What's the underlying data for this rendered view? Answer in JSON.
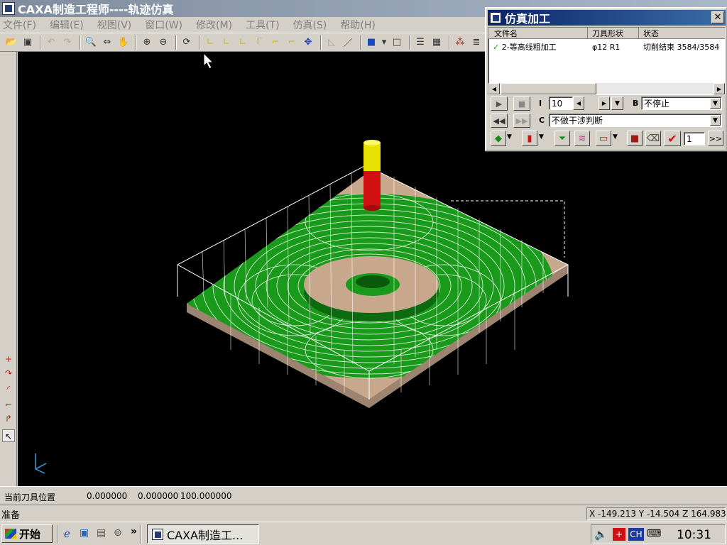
{
  "window": {
    "title": "CAXA制造工程师----轨迹仿真"
  },
  "menu": [
    "文件(F)",
    "编辑(E)",
    "视图(V)",
    "窗口(W)",
    "修改(M)",
    "工具(T)",
    "仿真(S)",
    "帮助(H)"
  ],
  "sim_panel": {
    "title": "仿真加工",
    "columns": [
      "文件名",
      "刀具形状",
      "状态"
    ],
    "rows": [
      {
        "name": "2-等高线粗加工",
        "tool": "φ12 R1",
        "status": "切削结束 3584/3584"
      }
    ],
    "label_i": "I",
    "step_value": "10",
    "label_b": "B",
    "stop_mode": "不停止",
    "label_c": "C",
    "interference": "不做干涉判断",
    "count_value": "1",
    "more_label": ">>"
  },
  "status": {
    "tool_pos_label": "当前刀具位置",
    "pos_x": "0.000000",
    "pos_y": "0.000000",
    "pos_z": "100.000000",
    "ready": "准备",
    "coords": "X -149.213 Y   -14.504 Z  164.983"
  },
  "taskbar": {
    "start": "开始",
    "task": "CAXA制造工...",
    "lang": "CH",
    "time": "10:31",
    "chevron": "»"
  },
  "colors": {
    "toolpath": "#22c022",
    "stock": "#c8a88c",
    "tool_tip": "#e8e000",
    "tool_body": "#d01010"
  }
}
